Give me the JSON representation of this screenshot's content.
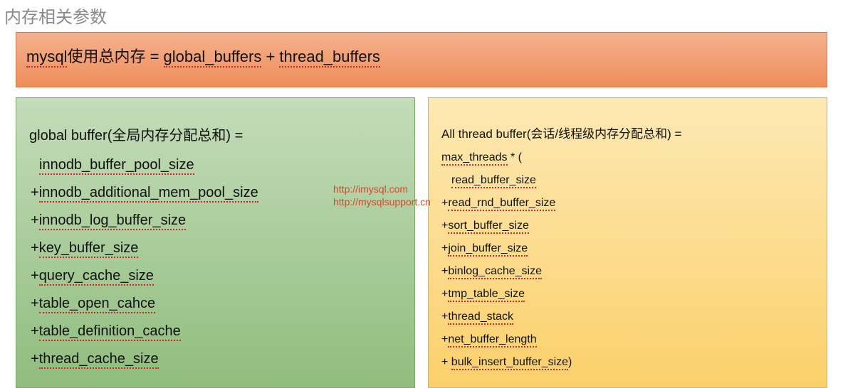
{
  "title": "内存相关参数",
  "formula": {
    "prefix": "mysql",
    "mid1": "使用总内存 = ",
    "t1": "global_buffers",
    "plus": " + ",
    "t2": "thread_buffers"
  },
  "left": {
    "head_plain": "global buffer(全局内存分配总和) =",
    "items": [
      "innodb_buffer_pool_size",
      "innodb_additional_mem_pool_size",
      "innodb_log_buffer_size",
      "key_buffer_size",
      "query_cache_size",
      "table_open_cahce",
      "table_definition_cache",
      "thread_cache_size"
    ]
  },
  "right": {
    "head_plain": "All thread buffer(会话/线程级内存分配总和) =",
    "lead_u": "max_threads",
    "lead_tail": "  * (",
    "items": [
      "read_buffer_size",
      "read_rnd_buffer_size",
      "sort_buffer_size",
      "join_buffer_size",
      "binlog_cache_size",
      "tmp_table_size",
      "thread_stack",
      "net_buffer_length",
      "bulk_insert_buffer_size"
    ],
    "close": ")"
  },
  "watermark": {
    "l1": "http://imysql.com",
    "l2": "http://mysqlsupport.cn"
  }
}
